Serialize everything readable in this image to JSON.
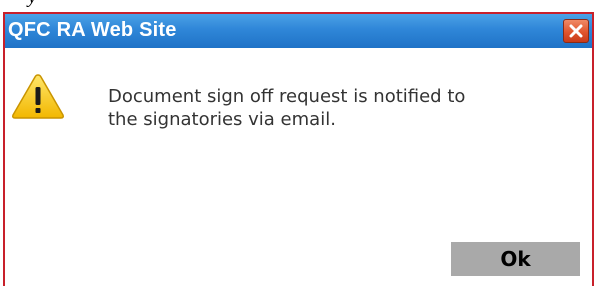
{
  "background_text": "y",
  "dialog": {
    "title": "QFC RA Web Site",
    "message_line1": "Document sign off request is notified to",
    "message_line2": "the signatories via email.",
    "ok_label": "Ok",
    "icon": "warning-icon",
    "close_icon": "close-icon"
  },
  "colors": {
    "titlebar": "#2f86d8",
    "border": "#c8202a",
    "ok_button": "#a9a9a9",
    "warning": "#f5c400"
  }
}
